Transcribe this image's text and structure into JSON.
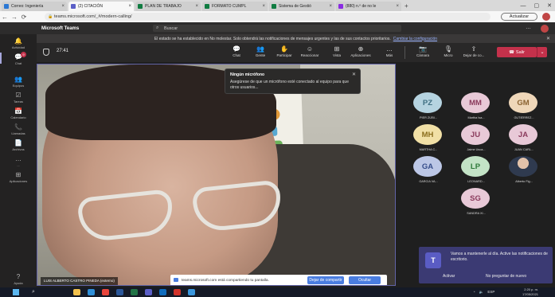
{
  "browser": {
    "tabs": [
      {
        "label": "Correo: Ingeniería",
        "color": "#2b78d4",
        "active": false
      },
      {
        "label": "(2) CITACIÓN",
        "color": "#5b5fc7",
        "active": true
      },
      {
        "label": "PLAN DE TRABAJO",
        "color": "#107c41",
        "active": false
      },
      {
        "label": "FORMATO CUMPL",
        "color": "#107c41",
        "active": false
      },
      {
        "label": "Sistema de Gestió",
        "color": "#107c41",
        "active": false
      },
      {
        "label": "(880) n.º de no le",
        "color": "#8a2be2",
        "active": false
      }
    ],
    "url": "teams.microsoft.com/_#/modern-calling/",
    "update_button": "Actualizar"
  },
  "teams": {
    "brand": "Microsoft Teams",
    "search_placeholder": "Buscar",
    "notice_text": "El estado se ha establecido en No molestar. Solo obtendrá las notificaciones de mensajes urgentes y las de sus contactos prioritarios.",
    "notice_link": "Cambiar la configuración"
  },
  "rail": [
    {
      "label": "Actividad",
      "icon": "bell-icon",
      "glyph": "🔔"
    },
    {
      "label": "Chat",
      "icon": "chat-icon",
      "glyph": "💬",
      "badge": "9"
    },
    {
      "label": "Equipos",
      "icon": "teams-icon",
      "glyph": "👥"
    },
    {
      "label": "Tareas",
      "icon": "tasks-icon",
      "glyph": "☑"
    },
    {
      "label": "Calendario",
      "icon": "calendar-icon",
      "glyph": "📅"
    },
    {
      "label": "Llamadas",
      "icon": "phone-icon",
      "glyph": "📞"
    },
    {
      "label": "Archivos",
      "icon": "files-icon",
      "glyph": "📄"
    },
    {
      "label": "...",
      "icon": "more-icon",
      "glyph": "…"
    },
    {
      "label": "Aplicaciones",
      "icon": "apps-icon",
      "glyph": "⊞"
    },
    {
      "label": "Ayuda",
      "icon": "help-icon",
      "glyph": "?"
    }
  ],
  "meeting": {
    "timer": "27:41",
    "controls": [
      {
        "label": "Chat",
        "icon": "chat-icon",
        "glyph": "💬"
      },
      {
        "label": "Gente",
        "icon": "people-icon",
        "glyph": "👥"
      },
      {
        "label": "Participar",
        "icon": "raise-hand-icon",
        "glyph": "✋"
      },
      {
        "label": "Reaccionar",
        "icon": "react-icon",
        "glyph": "☺"
      },
      {
        "label": "Vista",
        "icon": "view-icon",
        "glyph": "⊞"
      },
      {
        "label": "Aplicaciones",
        "icon": "apps-icon",
        "glyph": "⊕"
      },
      {
        "label": "Más",
        "icon": "more-icon",
        "glyph": "…"
      }
    ],
    "av_controls": [
      {
        "label": "Cámara",
        "icon": "camera-off-icon",
        "glyph": "📷"
      },
      {
        "label": "Micro",
        "icon": "mic-off-icon",
        "glyph": "🎙"
      },
      {
        "label": "Dejar de co...",
        "icon": "share-icon",
        "glyph": "⇪"
      }
    ],
    "leave_label": "Salir"
  },
  "video": {
    "participant_name": "LUIS ALBERTO CASTRO PINEDA (externo)",
    "tooltip_title": "Ningún micrófono",
    "tooltip_text": "Asegúrese de que un micrófono esté conectado al equipo para que otros usuarios...",
    "share_text": "teams.microsoft.com está compartiendo tu pantalla.",
    "share_stop": "Dejar de compartir",
    "share_hide": "Ocultar"
  },
  "participants": [
    {
      "initials": "PZ",
      "name": "PIER ZÚÑI...",
      "bg": "#b5d3e0",
      "fg": "#3f6f82"
    },
    {
      "initials": "MM",
      "name": "Martha Isa...",
      "bg": "#e8c9d7",
      "fg": "#8a3a5c"
    },
    {
      "initials": "GM",
      "name": "GUTIÉRREZ...",
      "bg": "#efd7b9",
      "fg": "#8a6230"
    },
    {
      "initials": "MH",
      "name": "MARTHA C...",
      "bg": "#f1e0a6",
      "fg": "#8a6d1c"
    },
    {
      "initials": "JU",
      "name": "Jaime Usca...",
      "bg": "#e8c9d7",
      "fg": "#8a3a5c"
    },
    {
      "initials": "JA",
      "name": "JUAN CARL...",
      "bg": "#e8c9d7",
      "fg": "#8a3a5c"
    },
    {
      "initials": "GA",
      "name": "GARCIA VA...",
      "bg": "#bcc7e6",
      "fg": "#364d8a"
    },
    {
      "initials": "LP",
      "name": "LEONARD...",
      "bg": "#c3e3c6",
      "fg": "#2f7a3a"
    },
    {
      "initials": "",
      "name": "Alberto Fig...",
      "bg": "#d9d2cb",
      "fg": "#333333"
    },
    {
      "initials": "SG",
      "name": "SANDRA XI...",
      "bg": "#e8c9d7",
      "fg": "#8a3a5c"
    }
  ],
  "toast": {
    "text": "Vamos a mantenerle al día. Active las notificaciones de escritorio.",
    "activate": "Activar",
    "dismiss": "No preguntar de nuevo"
  },
  "taskbar": {
    "lang": "ESP",
    "time": "2:20 p. m.",
    "date": "17/05/2021"
  },
  "colors": {
    "accent": "#6264a7",
    "leave": "#c4314b",
    "toast": "#3b3a73"
  }
}
